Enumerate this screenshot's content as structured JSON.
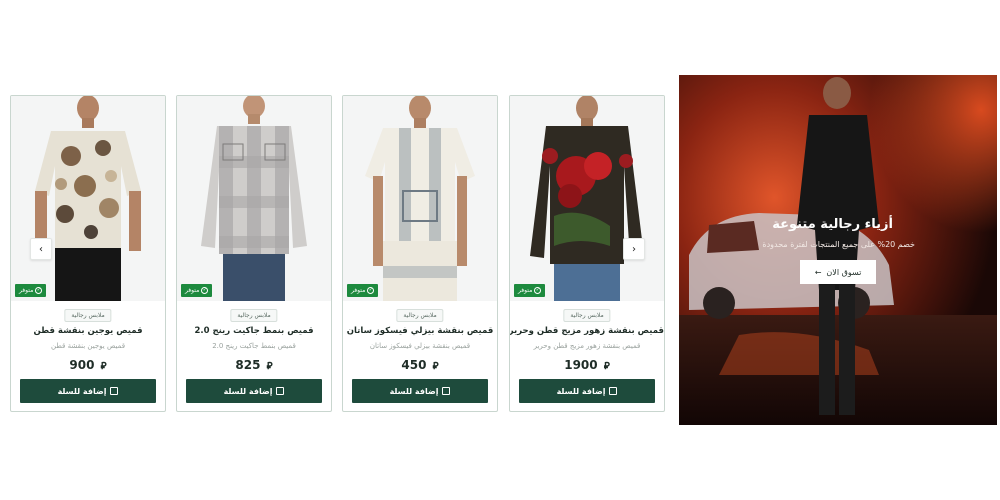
{
  "products": [
    {
      "badge": "متوفر",
      "category": "ملابس رجالية",
      "title": "قميص يوجين بنقشة قطن",
      "subtitle": "قميص يوجين بنقشة قطن",
      "price": "900",
      "currency": "⃁",
      "add_label": "إضافة للسلة"
    },
    {
      "badge": "متوفر",
      "category": "ملابس رجالية",
      "title": "قميص بنمط جاكيت رينج 2.0",
      "subtitle": "قميص بنمط جاكيت رينج 2.0",
      "price": "825",
      "currency": "⃁",
      "add_label": "إضافة للسلة"
    },
    {
      "badge": "متوفر",
      "category": "ملابس رجالية",
      "title": "قميص بنقشة بيزلي فيسكوز ساتان",
      "subtitle": "قميص بنقشة بيزلي فيسكوز ساتان",
      "price": "450",
      "currency": "⃁",
      "add_label": "إضافة للسلة"
    },
    {
      "badge": "متوفر",
      "category": "ملابس رجالية",
      "title": "قميص بنقشة زهور مزيج قطن وحرير",
      "subtitle": "قميص بنقشة زهور مزيج قطن وحرير",
      "price": "1900",
      "currency": "⃁",
      "add_label": "إضافة للسلة"
    }
  ],
  "hero": {
    "title": "أزياء رجالية متنوعة",
    "subtitle": "خصم 20% على جميع المنتجات لفترة محدودة",
    "cta": "تسوق الان"
  },
  "icons": {
    "prev": "chevron-left-icon",
    "next": "chevron-right-icon",
    "bag": "shopping-bag-icon",
    "check": "check-circle-icon",
    "cta_arrow": "arrow-left-icon"
  },
  "colors": {
    "primary": "#1e4b3c",
    "badge": "#1d8a3e"
  }
}
